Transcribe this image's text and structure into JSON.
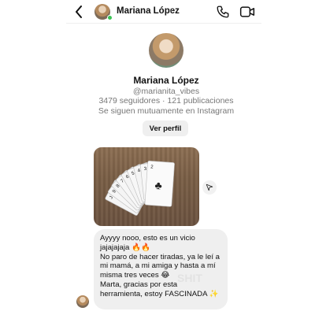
{
  "header": {
    "contact_name": "Mariana López",
    "chevron": "›",
    "back_icon": "chevron-left-icon",
    "call_icon": "phone-icon",
    "video_icon": "video-camera-icon",
    "online_color": "#3bc255"
  },
  "profile": {
    "name": "Mariana López",
    "handle": "@marianita_vibes",
    "stats": "3479 seguidores · 121 publicaciones",
    "mutual": "Se siguen mutuamente en Instagram",
    "view_profile_label": "Ver perfil"
  },
  "messages": {
    "photo_alt": "Cartas de póker en abanico sobre mesa de madera",
    "share_icon": "send-icon",
    "text_lines": [
      "Ayyyy nooo, esto es un vicio jajajajaja 🔥🔥",
      "No paro de hacer tiradas, ya le leí a mi mamá, a mi amiga y hasta a mí misma tres veces 😂",
      "Marta, gracias por esta herramienta, estoy FASCINADA ✨"
    ],
    "watermark": "SHIT"
  },
  "colors": {
    "bubble_bg": "#efefef",
    "button_bg": "#efefef",
    "secondary_text": "#777777"
  }
}
